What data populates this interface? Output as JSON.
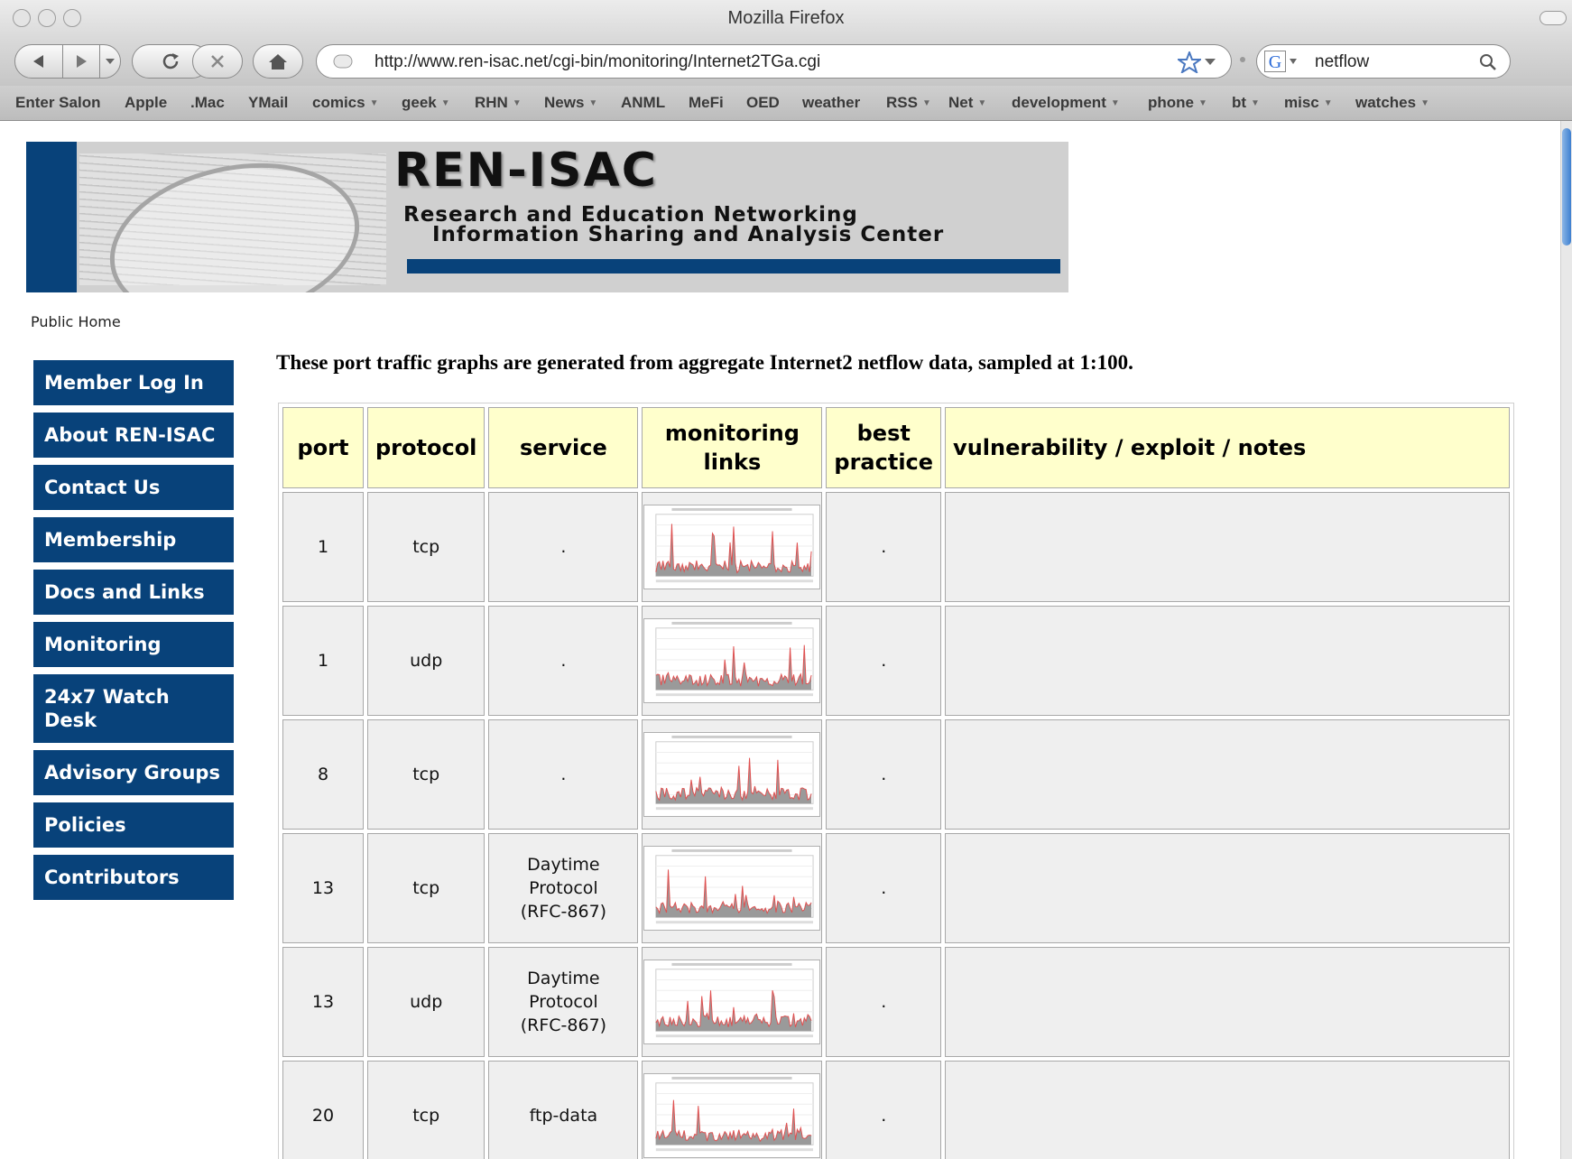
{
  "window": {
    "title": "Mozilla Firefox"
  },
  "toolbar": {
    "url": "http://www.ren-isac.net/cgi-bin/monitoring/Internet2TGa.cgi",
    "search_value": "netflow"
  },
  "bookmarks": [
    {
      "label": "Enter Salon",
      "menu": false
    },
    {
      "label": "Apple",
      "menu": false
    },
    {
      "label": ".Mac",
      "menu": false
    },
    {
      "label": "YMail",
      "menu": false
    },
    {
      "label": "comics",
      "menu": true
    },
    {
      "label": "geek",
      "menu": true
    },
    {
      "label": "RHN",
      "menu": true
    },
    {
      "label": "News",
      "menu": true
    },
    {
      "label": "ANML",
      "menu": false
    },
    {
      "label": "MeFi",
      "menu": false
    },
    {
      "label": "OED",
      "menu": false
    },
    {
      "label": "weather",
      "menu": false
    },
    {
      "label": "RSS",
      "menu": true
    },
    {
      "label": "Net",
      "menu": true
    },
    {
      "label": "development",
      "menu": true
    },
    {
      "label": "phone",
      "menu": true
    },
    {
      "label": "bt",
      "menu": true
    },
    {
      "label": "misc",
      "menu": true
    },
    {
      "label": "watches",
      "menu": true
    }
  ],
  "banner": {
    "title": "REN-ISAC",
    "subtitle_line1": "Research and Education Networking",
    "subtitle_line2": "Information Sharing and Analysis Center"
  },
  "breadcrumb": "Public Home",
  "sidebar": {
    "items": [
      {
        "label": "Member Log In"
      },
      {
        "label": "About REN-ISAC"
      },
      {
        "label": "Contact Us"
      },
      {
        "label": "Membership"
      },
      {
        "label": "Docs and Links"
      },
      {
        "label": "Monitoring"
      },
      {
        "label": "24x7 Watch Desk"
      },
      {
        "label": "Advisory Groups"
      },
      {
        "label": "Policies"
      },
      {
        "label": "Contributors"
      }
    ]
  },
  "intro": "These port traffic graphs are generated from aggregate Internet2 netflow data, sampled at 1:100.",
  "table": {
    "headers": [
      "port",
      "protocol",
      "service",
      "monitoring links",
      "best practice",
      "vulnerability / exploit / notes"
    ],
    "rows": [
      {
        "port": "1",
        "protocol": "tcp",
        "service": ".",
        "best_practice": ".",
        "notes": ""
      },
      {
        "port": "1",
        "protocol": "udp",
        "service": ".",
        "best_practice": ".",
        "notes": ""
      },
      {
        "port": "8",
        "protocol": "tcp",
        "service": ".",
        "best_practice": ".",
        "notes": ""
      },
      {
        "port": "13",
        "protocol": "tcp",
        "service": "Daytime Protocol (RFC-867)",
        "best_practice": ".",
        "notes": ""
      },
      {
        "port": "13",
        "protocol": "udp",
        "service": "Daytime Protocol (RFC-867)",
        "best_practice": ".",
        "notes": ""
      },
      {
        "port": "20",
        "protocol": "tcp",
        "service": "ftp-data",
        "best_practice": ".",
        "notes": ""
      }
    ]
  },
  "colors": {
    "nav_blue": "#08427a",
    "header_yellow": "#ffffcc",
    "cell_gray": "#efefef"
  }
}
